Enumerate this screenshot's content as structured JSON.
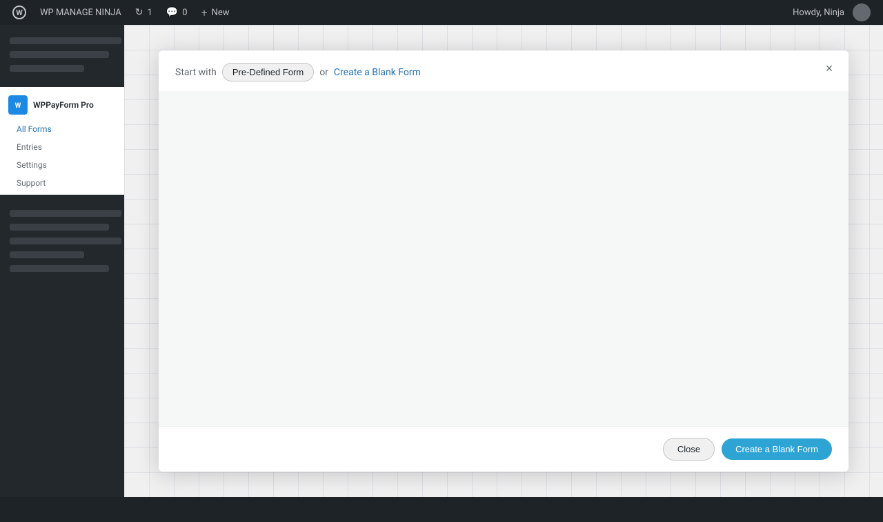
{
  "adminbar": {
    "wp_label": "W",
    "site_name": "WP MANAGE NINJA",
    "updates_label": "1",
    "comments_label": "0",
    "new_label": "New",
    "user_greeting": "Howdy, Ninja"
  },
  "sidebar": {
    "plugin_name": "WPPayForm Pro",
    "menu_items": [
      {
        "label": "All Forms",
        "active": true
      },
      {
        "label": "Entries",
        "active": false
      },
      {
        "label": "Settings",
        "active": false
      },
      {
        "label": "Support",
        "active": false
      }
    ]
  },
  "modal": {
    "start_with_text": "Start with",
    "tab_predefined": "Pre-Defined Form",
    "or_text": "or",
    "create_blank_link": "Create a Blank Form",
    "close_label": "Close",
    "create_blank_button": "Create a Blank Form"
  }
}
